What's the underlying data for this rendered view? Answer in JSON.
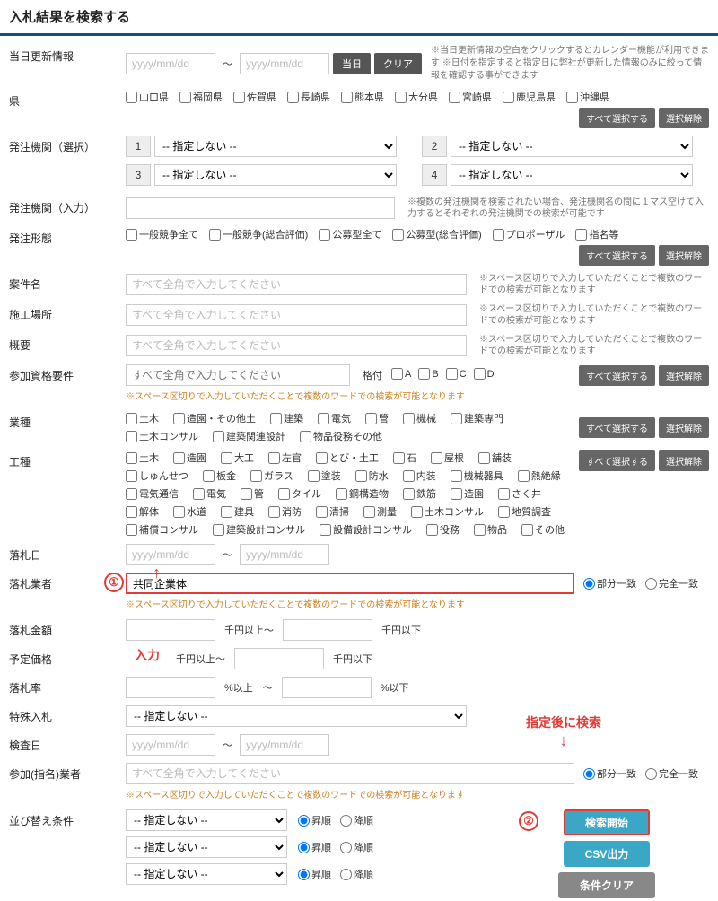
{
  "header": {
    "title": "入札結果を検索する"
  },
  "dateUpdate": {
    "label": "当日更新情報",
    "placeholder": "yyyy/mm/dd",
    "todayBtn": "当日",
    "clearBtn": "クリア",
    "note": "※当日更新情報の空白をクリックするとカレンダー機能が利用できます\n※日付を指定すると指定日に弊社が更新した情報のみに絞って情報を確認する事ができます"
  },
  "prefecture": {
    "label": "県",
    "items": [
      "山口県",
      "福岡県",
      "佐賀県",
      "長崎県",
      "熊本県",
      "大分県",
      "宮崎県",
      "鹿児島県",
      "沖縄県"
    ],
    "selectAll": "すべて選択する",
    "deselect": "選択解除"
  },
  "orgSelect": {
    "label": "発注機関（選択）",
    "placeholder": "-- 指定しない --",
    "nums": [
      "1",
      "2",
      "3",
      "4"
    ]
  },
  "orgInput": {
    "label": "発注機関（入力）",
    "note": "※複数の発注機関を検索されたい場合、発注機関名の間に１マス空けて入力するとそれぞれの発注機関での検索が可能です"
  },
  "bidType": {
    "label": "発注形態",
    "items": [
      "一般競争全て",
      "一般競争(総合評価)",
      "公募型全て",
      "公募型(総合評価)",
      "プロポーザル",
      "指名等"
    ],
    "selectAll": "すべて選択する",
    "deselect": "選択解除"
  },
  "projectName": {
    "label": "案件名",
    "placeholder": "すべて全角で入力してください",
    "note": "※スペース区切りで入力していただくことで複数のワードでの検索が可能となります"
  },
  "location": {
    "label": "施工場所",
    "placeholder": "すべて全角で入力してください",
    "note": "※スペース区切りで入力していただくことで複数のワードでの検索が可能となります"
  },
  "summary": {
    "label": "概要",
    "placeholder": "すべて全角で入力してください",
    "note": "※スペース区切りで入力していただくことで複数のワードでの検索が可能となります"
  },
  "qualification": {
    "label": "参加資格要件",
    "placeholder": "すべて全角で入力してください",
    "gradeLabel": "格付",
    "grades": [
      "A",
      "B",
      "C",
      "D"
    ],
    "note": "※スペース区切りで入力していただくことで複数のワードでの検索が可能となります",
    "selectAll": "すべて選択する",
    "deselect": "選択解除"
  },
  "industry": {
    "label": "業種",
    "items": [
      "土木",
      "造園・その他土",
      "建築",
      "電気",
      "管",
      "機械",
      "建築専門",
      "土木コンサル",
      "建築関連設計",
      "物品役務その他"
    ],
    "selectAll": "すべて選択する",
    "deselect": "選択解除"
  },
  "workType": {
    "label": "工種",
    "items": [
      "土木",
      "造園",
      "大工",
      "左官",
      "とび・土工",
      "石",
      "屋根",
      "舗装",
      "しゅんせつ",
      "板金",
      "ガラス",
      "塗装",
      "防水",
      "内装",
      "機械器具",
      "熱絶縁",
      "電気通信",
      "電気",
      "管",
      "タイル",
      "鋼構造物",
      "鉄筋",
      "造園",
      "さく井",
      "解体",
      "水道",
      "建具",
      "消防",
      "清掃",
      "測量",
      "土木コンサル",
      "地質調査",
      "補償コンサル",
      "建築設計コンサル",
      "設備設計コンサル",
      "役務",
      "物品",
      "その他"
    ],
    "selectAll": "すべて選択する",
    "deselect": "選択解除"
  },
  "awardDate": {
    "label": "落札日",
    "placeholder": "yyyy/mm/dd"
  },
  "awardCompany": {
    "label": "落札業者",
    "value": "共同企業体",
    "partial": "部分一致",
    "exact": "完全一致",
    "note": "※スペース区切りで入力していただくことで複数のワードでの検索が可能となります"
  },
  "awardAmount": {
    "label": "落札金額",
    "unitFrom": "千円以上～",
    "unitTo": "千円以下"
  },
  "estPrice": {
    "label": "予定価格",
    "unitFrom": "千円以上～",
    "unitTo": "千円以下"
  },
  "awardRate": {
    "label": "落札率",
    "unitFrom": "%以上　～",
    "unitTo": "%以下"
  },
  "special": {
    "label": "特殊入札",
    "placeholder": "-- 指定しない --"
  },
  "inspectDate": {
    "label": "検査日",
    "placeholder": "yyyy/mm/dd"
  },
  "nominee": {
    "label": "参加(指名)業者",
    "placeholder": "すべて全角で入力してください",
    "partial": "部分一致",
    "exact": "完全一致",
    "note": "※スペース区切りで入力していただくことで複数のワードでの検索が可能となります"
  },
  "sort": {
    "label": "並び替え条件",
    "placeholder": "-- 指定しない --",
    "asc": "昇順",
    "desc": "降順"
  },
  "actions": {
    "search": "検索開始",
    "csv": "CSV出力",
    "clear": "条件クリア"
  },
  "annotations": {
    "num1": "①",
    "num2": "②",
    "input": "入力",
    "searchAfter": "指定後に検索"
  }
}
